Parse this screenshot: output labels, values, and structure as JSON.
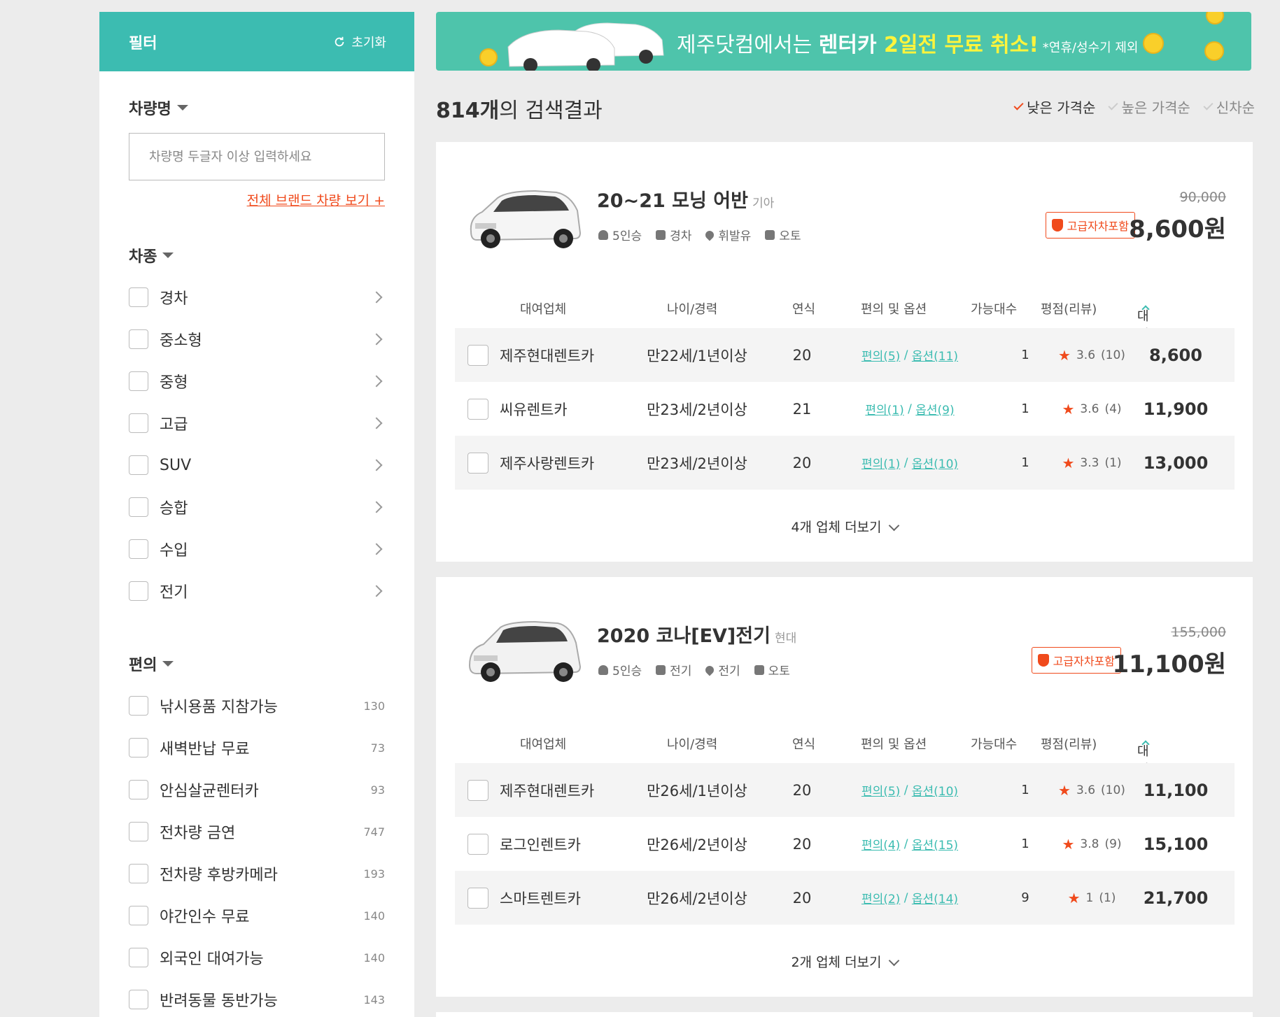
{
  "sidebar": {
    "title": "필터",
    "reset_label": "초기화",
    "name_section": {
      "title": "차량명",
      "placeholder": "차량명 두글자 이상 입력하세요",
      "all_brands_link": "전체 브랜드 차량 보기 +"
    },
    "type_section": {
      "title": "차종",
      "items": [
        "경차",
        "중소형",
        "중형",
        "고급",
        "SUV",
        "승합",
        "수입",
        "전기"
      ]
    },
    "convenience_section": {
      "title": "편의",
      "items": [
        {
          "label": "낚시용품 지참가능",
          "count": "130"
        },
        {
          "label": "새벽반납 무료",
          "count": "73"
        },
        {
          "label": "안심살균렌터카",
          "count": "93"
        },
        {
          "label": "전차량 금연",
          "count": "747"
        },
        {
          "label": "전차량 후방카메라",
          "count": "193"
        },
        {
          "label": "야간인수 무료",
          "count": "140"
        },
        {
          "label": "외국인 대여가능",
          "count": "140"
        },
        {
          "label": "반려동물 동반가능",
          "count": "143"
        }
      ]
    }
  },
  "banner": {
    "text_pre": "제주닷컴에서는 ",
    "text_em1": "렌터카 ",
    "text_em2": "2일전 무료 취소!",
    "text_sub": " *연휴/성수기 제외"
  },
  "results": {
    "count": "814개",
    "count_suffix": "의 검색결과",
    "sort": [
      "낮은 가격순",
      "높은 가격순",
      "신차순"
    ]
  },
  "table_headers": [
    "대여업체",
    "나이/경력",
    "연식",
    "편의 및 옵션",
    "가능대수",
    "평점(리뷰)",
    "대여료"
  ],
  "cars": [
    {
      "name": "20~21 모닝 어반",
      "brand": "기아",
      "specs": [
        "5인승",
        "경차",
        "휘발유",
        "오토"
      ],
      "badge": "고급자차포함",
      "price_old": "90,000",
      "price": "8,600원",
      "rows": [
        {
          "vendor": "제주현대렌트카",
          "age": "만22세/1년이상",
          "year": "20",
          "conv": "편의(5)",
          "opt": "옵션(11)",
          "avail": "1",
          "rating": "3.6",
          "reviews": "(10)",
          "price": "8,600"
        },
        {
          "vendor": "씨유렌트카",
          "age": "만23세/2년이상",
          "year": "21",
          "conv": "편의(1)",
          "opt": "옵션(9)",
          "avail": "1",
          "rating": "3.6",
          "reviews": "(4)",
          "price": "11,900"
        },
        {
          "vendor": "제주사랑렌트카",
          "age": "만23세/2년이상",
          "year": "20",
          "conv": "편의(1)",
          "opt": "옵션(10)",
          "avail": "1",
          "rating": "3.3",
          "reviews": "(1)",
          "price": "13,000"
        }
      ],
      "more": "4개 업체 더보기"
    },
    {
      "name": "2020 코나[EV]전기",
      "brand": "현대",
      "specs": [
        "5인승",
        "전기",
        "전기",
        "오토"
      ],
      "badge": "고급자차포함",
      "price_old": "155,000",
      "price": "11,100원",
      "rows": [
        {
          "vendor": "제주현대렌트카",
          "age": "만26세/1년이상",
          "year": "20",
          "conv": "편의(5)",
          "opt": "옵션(10)",
          "avail": "1",
          "rating": "3.6",
          "reviews": "(10)",
          "price": "11,100"
        },
        {
          "vendor": "로그인렌트카",
          "age": "만26세/2년이상",
          "year": "20",
          "conv": "편의(4)",
          "opt": "옵션(15)",
          "avail": "1",
          "rating": "3.8",
          "reviews": "(9)",
          "price": "15,100"
        },
        {
          "vendor": "스마트렌트카",
          "age": "만26세/2년이상",
          "year": "20",
          "conv": "편의(2)",
          "opt": "옵션(14)",
          "avail": "9",
          "rating": "1",
          "reviews": "(1)",
          "price": "21,700"
        }
      ],
      "more": "2개 업체 더보기"
    }
  ],
  "colors": {
    "accent": "#3cbcb1",
    "highlight": "#f04a1c",
    "banner": "#4ec4ab",
    "banner_yellow": "#fff43c"
  }
}
